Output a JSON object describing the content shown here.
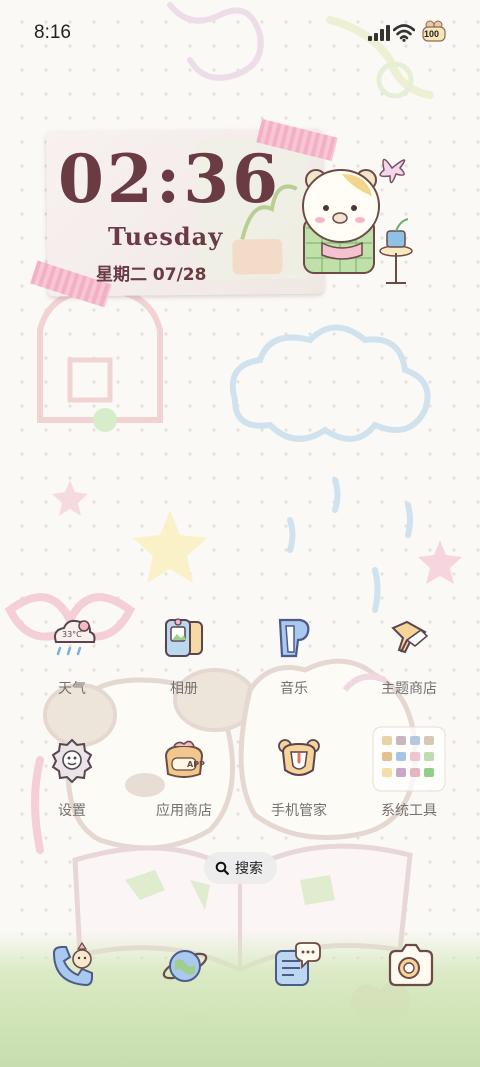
{
  "status_bar": {
    "time": "8:16",
    "battery_level": "100"
  },
  "clock_widget": {
    "time": "02:36",
    "weekday": "Tuesday",
    "date_cn": "星期二 07/28"
  },
  "apps": [
    {
      "label": "天气",
      "icon": "weather-icon"
    },
    {
      "label": "相册",
      "icon": "gallery-icon"
    },
    {
      "label": "音乐",
      "icon": "music-icon"
    },
    {
      "label": "主题商店",
      "icon": "theme-store-icon"
    },
    {
      "label": "设置",
      "icon": "settings-icon"
    },
    {
      "label": "应用商店",
      "icon": "app-store-icon"
    },
    {
      "label": "手机管家",
      "icon": "phone-manager-icon"
    },
    {
      "label": "系统工具",
      "icon": "system-tools-folder-icon"
    }
  ],
  "weather_icon_text": "33°C",
  "app_store_icon_text": "APP",
  "search": {
    "label": "搜索"
  },
  "dock": [
    {
      "icon": "phone-icon"
    },
    {
      "icon": "browser-icon"
    },
    {
      "icon": "messages-icon"
    },
    {
      "icon": "camera-icon"
    }
  ],
  "colors": {
    "clock_text": "#6b3b44",
    "label_text": "#757070",
    "background": "#fbf9f6"
  }
}
